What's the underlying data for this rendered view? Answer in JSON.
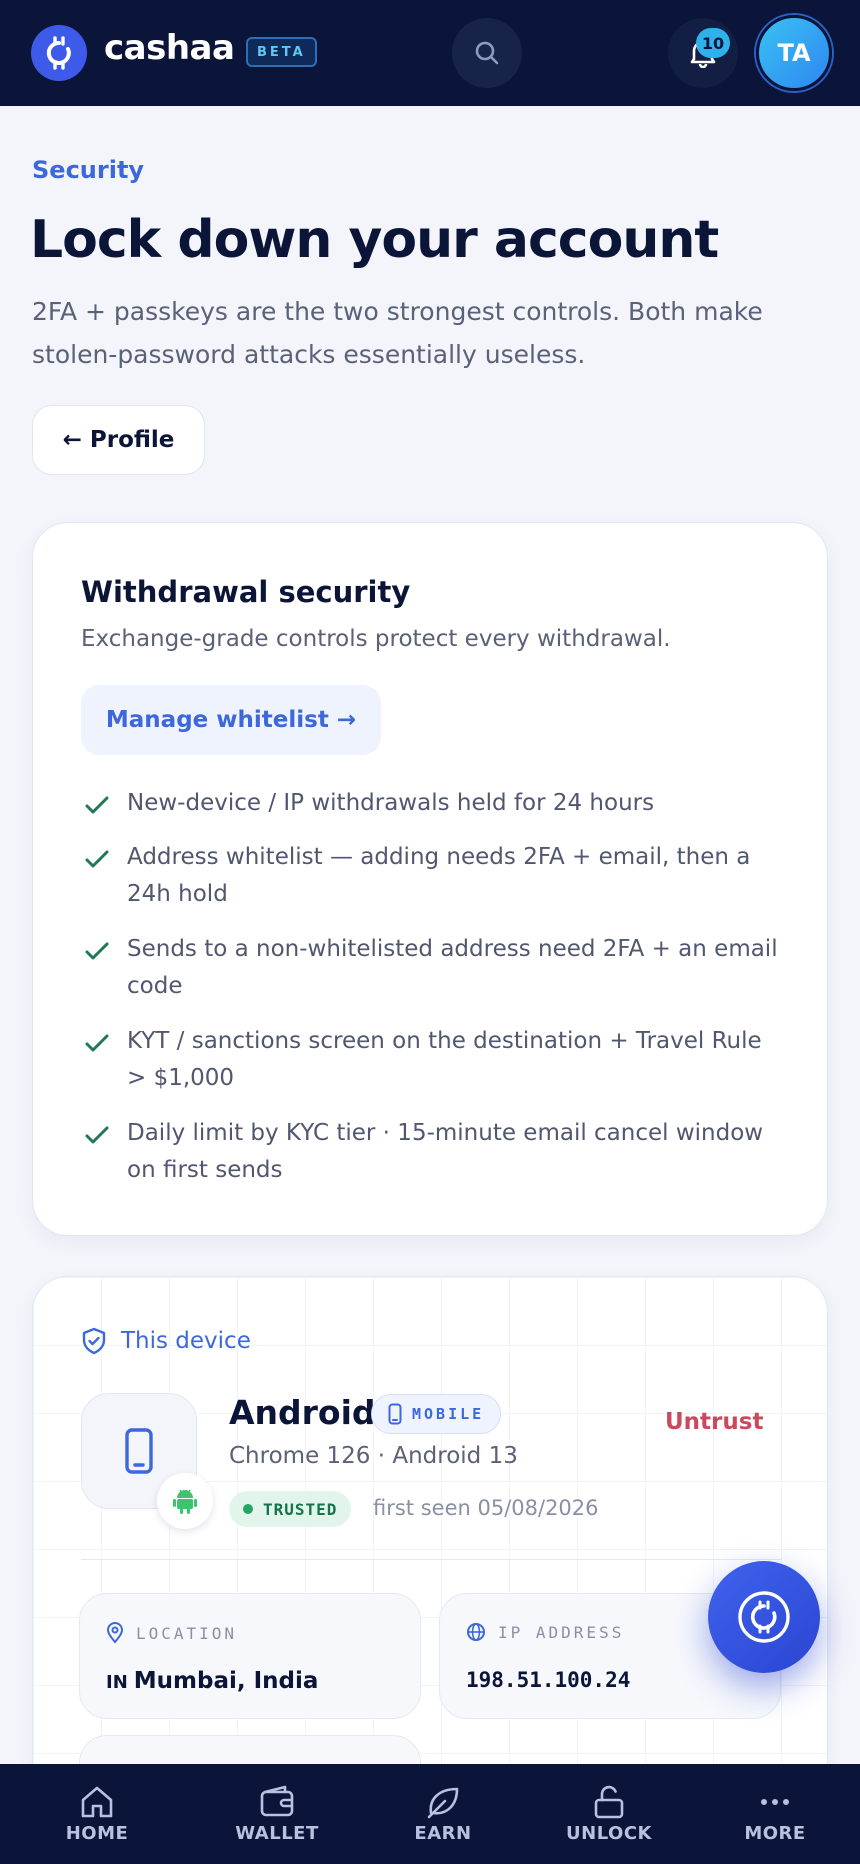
{
  "header": {
    "brand": "cashaa",
    "beta_label": "BETA",
    "notification_count": "10",
    "avatar_initials": "TA"
  },
  "intro": {
    "eyebrow": "Security",
    "title": "Lock down your account",
    "description": "2FA + passkeys are the two strongest controls. Both make stolen-password attacks essentially useless.",
    "back_label": "← Profile"
  },
  "withdrawal": {
    "title": "Withdrawal security",
    "subtitle": "Exchange-grade controls protect every withdrawal.",
    "whitelist_label": "Manage whitelist →",
    "checks": [
      "New-device / IP withdrawals held for 24 hours",
      "Address whitelist — adding needs 2FA + email, then a 24h hold",
      "Sends to a non-whitelisted address need 2FA + an email code",
      "KYT / sanctions screen on the destination + Travel Rule > $1,000",
      "Daily limit by KYC tier · 15-minute email cancel window on first sends"
    ]
  },
  "device": {
    "section_label": "This device",
    "name": "Android",
    "type_chip": "MOBILE",
    "untrust_label": "Untrust",
    "meta": "Chrome 126 · Android 13",
    "trusted_label": "TRUSTED",
    "first_seen": "first seen 05/08/2026",
    "location_label": "LOCATION",
    "location_country": "IN",
    "location_value": "Mumbai, India",
    "ip_label": "IP ADDRESS",
    "ip_value": "198.51.100.24"
  },
  "nav": {
    "items": [
      {
        "label": "HOME",
        "icon": "home-icon"
      },
      {
        "label": "WALLET",
        "icon": "wallet-icon"
      },
      {
        "label": "EARN",
        "icon": "leaf-icon"
      },
      {
        "label": "UNLOCK",
        "icon": "unlock-icon"
      },
      {
        "label": "MORE",
        "icon": "more-icon"
      }
    ]
  },
  "colors": {
    "navy": "#0b1539",
    "accent": "#3d68dc",
    "success": "#14744a",
    "danger": "#c94a5c"
  }
}
